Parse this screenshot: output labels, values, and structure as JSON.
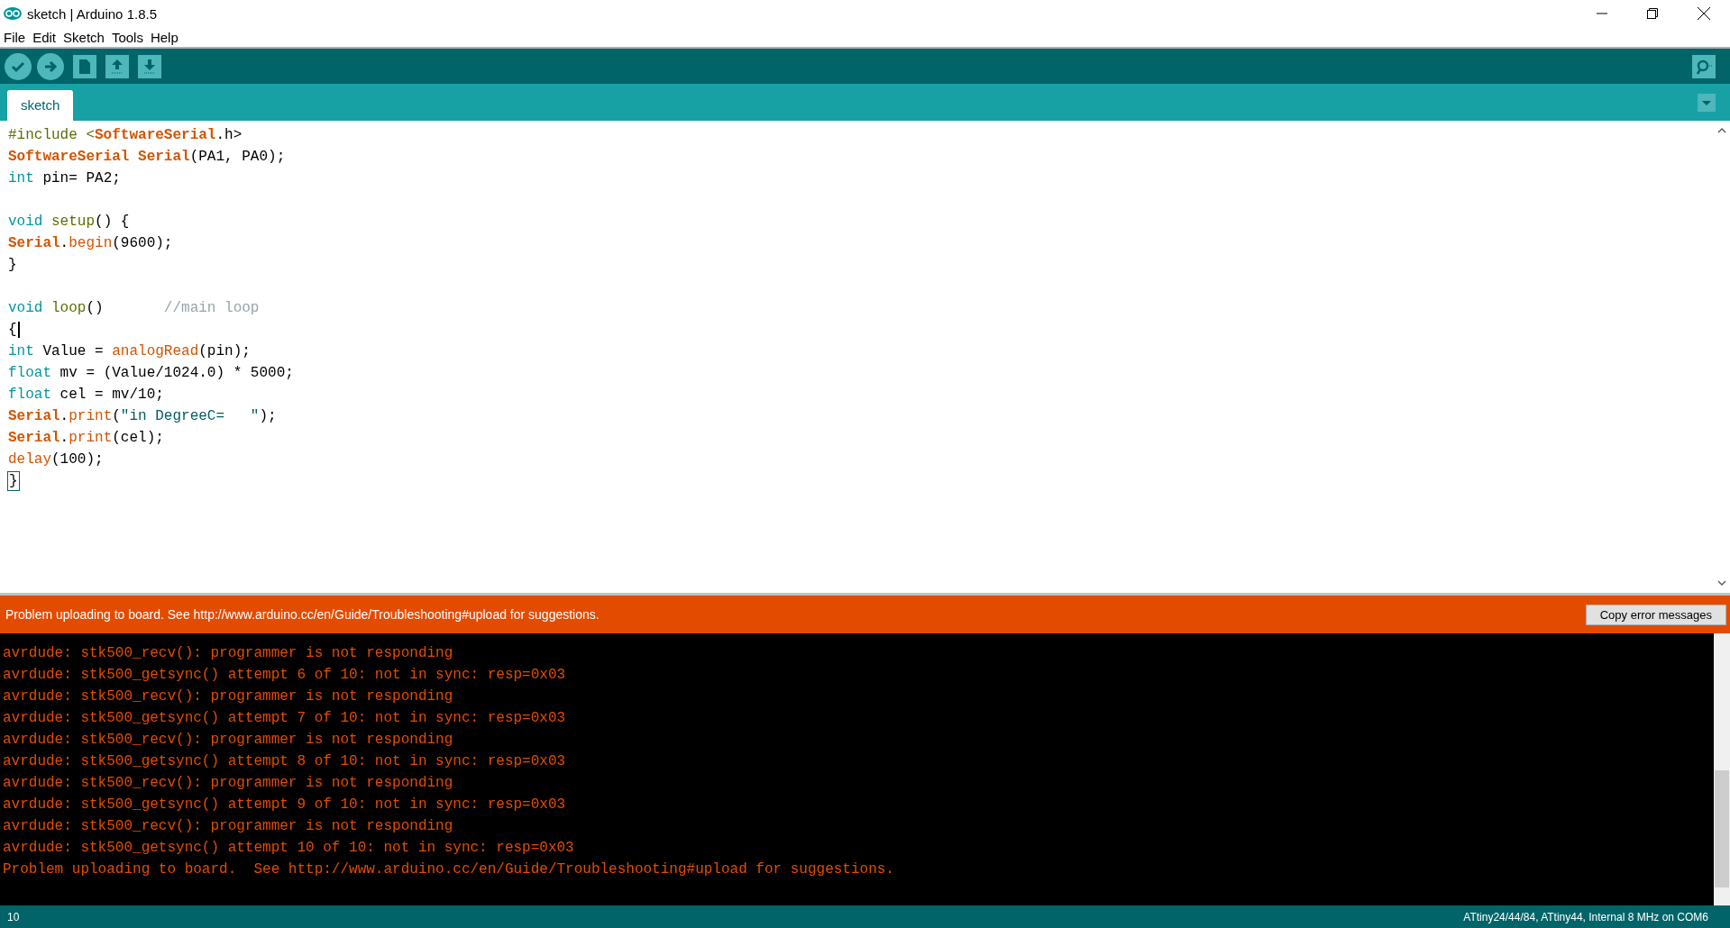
{
  "window": {
    "title": "sketch | Arduino 1.8.5"
  },
  "menu": [
    "File",
    "Edit",
    "Sketch",
    "Tools",
    "Help"
  ],
  "toolbar": [
    {
      "kind": "verify"
    },
    {
      "kind": "upload"
    },
    {
      "kind": "new"
    },
    {
      "kind": "open"
    },
    {
      "kind": "save"
    }
  ],
  "tabs": [
    {
      "label": "sketch",
      "selected": true
    }
  ],
  "editor": {
    "lines": [
      {
        "tokens": [
          {
            "text": "#include <",
            "kind": "pre"
          },
          {
            "text": "SoftwareSerial",
            "kind": "cls"
          },
          {
            "text": ".h>",
            "kind": "plain"
          }
        ]
      },
      {
        "tokens": [
          {
            "text": "SoftwareSerial ",
            "kind": "cls"
          },
          {
            "text": "Serial",
            "kind": "cls"
          },
          {
            "text": "(PA1, PA0);",
            "kind": "plain"
          }
        ]
      },
      {
        "tokens": [
          {
            "text": "int",
            "kind": "type"
          },
          {
            "text": " pin= PA2;",
            "kind": "plain"
          }
        ]
      },
      {
        "kind": "blank"
      },
      {
        "tokens": [
          {
            "text": "void ",
            "kind": "type"
          },
          {
            "text": "setup",
            "kind": "fn"
          },
          {
            "text": "() {",
            "kind": "plain"
          }
        ]
      },
      {
        "tokens": [
          {
            "text": "Serial",
            "kind": "cls"
          },
          {
            "text": ".",
            "kind": "plain"
          },
          {
            "text": "begin",
            "kind": "builtin"
          },
          {
            "text": "(9600);",
            "kind": "plain"
          }
        ]
      },
      {
        "tokens": [
          {
            "text": "}",
            "kind": "plain"
          }
        ]
      },
      {
        "kind": "blank"
      },
      {
        "tokens": [
          {
            "text": "void ",
            "kind": "type"
          },
          {
            "text": "loop",
            "kind": "fn"
          },
          {
            "text": "()       ",
            "kind": "plain"
          },
          {
            "text": "//main loop",
            "kind": "comment"
          }
        ]
      },
      {
        "cursor": true,
        "tokens": [
          {
            "text": "{",
            "kind": "plain"
          }
        ]
      },
      {
        "tokens": [
          {
            "text": "int",
            "kind": "type"
          },
          {
            "text": " Value = ",
            "kind": "plain"
          },
          {
            "text": "analogRead",
            "kind": "builtin"
          },
          {
            "text": "(pin);",
            "kind": "plain"
          }
        ]
      },
      {
        "tokens": [
          {
            "text": "float",
            "kind": "type"
          },
          {
            "text": " mv = (Value/1024.0) * 5000;",
            "kind": "plain"
          }
        ]
      },
      {
        "tokens": [
          {
            "text": "float",
            "kind": "type"
          },
          {
            "text": " cel = mv/10;",
            "kind": "plain"
          }
        ]
      },
      {
        "tokens": [
          {
            "text": "Serial",
            "kind": "cls"
          },
          {
            "text": ".",
            "kind": "plain"
          },
          {
            "text": "print",
            "kind": "builtin"
          },
          {
            "text": "(",
            "kind": "plain"
          },
          {
            "text": "\"in DegreeC=   \"",
            "kind": "string"
          },
          {
            "text": ");",
            "kind": "plain"
          }
        ]
      },
      {
        "tokens": [
          {
            "text": "Serial",
            "kind": "cls"
          },
          {
            "text": ".",
            "kind": "plain"
          },
          {
            "text": "print",
            "kind": "builtin"
          },
          {
            "text": "(cel);",
            "kind": "plain"
          }
        ]
      },
      {
        "tokens": [
          {
            "text": "delay",
            "kind": "builtin"
          },
          {
            "text": "(100);",
            "kind": "plain"
          }
        ]
      },
      {
        "matched": true,
        "tokens": [
          {
            "text": "}",
            "kind": "plain"
          }
        ]
      }
    ]
  },
  "notice": {
    "message": "Problem uploading to board.  See http://www.arduino.cc/en/Guide/Troubleshooting#upload for suggestions.",
    "button": "Copy error messages"
  },
  "console": {
    "lines": [
      "avrdude: stk500_recv(): programmer is not responding",
      "avrdude: stk500_getsync() attempt 6 of 10: not in sync: resp=0x03",
      "avrdude: stk500_recv(): programmer is not responding",
      "avrdude: stk500_getsync() attempt 7 of 10: not in sync: resp=0x03",
      "avrdude: stk500_recv(): programmer is not responding",
      "avrdude: stk500_getsync() attempt 8 of 10: not in sync: resp=0x03",
      "avrdude: stk500_recv(): programmer is not responding",
      "avrdude: stk500_getsync() attempt 9 of 10: not in sync: resp=0x03",
      "avrdude: stk500_recv(): programmer is not responding",
      "avrdude: stk500_getsync() attempt 10 of 10: not in sync: resp=0x03",
      "Problem uploading to board.  See http://www.arduino.cc/en/Guide/Troubleshooting#upload for suggestions."
    ]
  },
  "status_bar": {
    "line": "10",
    "board": "ATtiny24/44/84, ATtiny44, Internal 8 MHz on COM6"
  }
}
